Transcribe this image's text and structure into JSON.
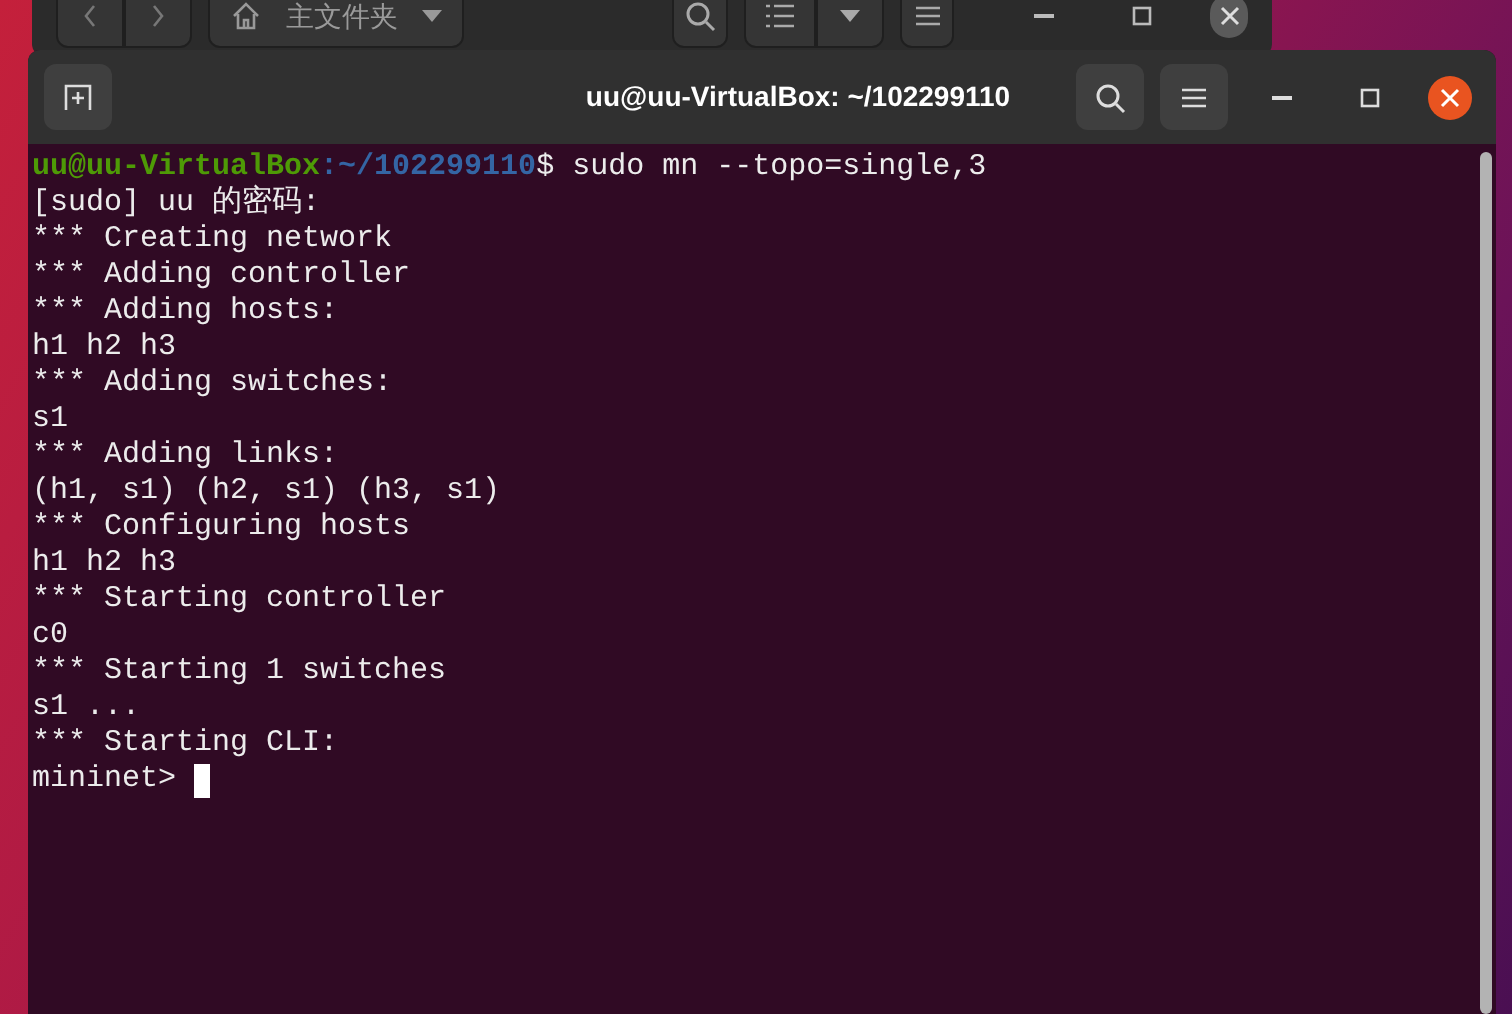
{
  "file_manager": {
    "path_label": "主文件夹"
  },
  "terminal": {
    "title": "uu@uu-VirtualBox: ~/102299110",
    "lines": [
      {
        "kind": "prompt",
        "user_host": "uu@uu-VirtualBox",
        "path": ":~/102299110",
        "command": "$ sudo mn --topo=single,3"
      },
      {
        "kind": "output",
        "text": "[sudo] uu 的密码:"
      },
      {
        "kind": "output",
        "text": "*** Creating network"
      },
      {
        "kind": "output",
        "text": "*** Adding controller"
      },
      {
        "kind": "output",
        "text": "*** Adding hosts:"
      },
      {
        "kind": "output",
        "text": "h1 h2 h3"
      },
      {
        "kind": "output",
        "text": "*** Adding switches:"
      },
      {
        "kind": "output",
        "text": "s1"
      },
      {
        "kind": "output",
        "text": "*** Adding links:"
      },
      {
        "kind": "output",
        "text": "(h1, s1) (h2, s1) (h3, s1)"
      },
      {
        "kind": "output",
        "text": "*** Configuring hosts"
      },
      {
        "kind": "output",
        "text": "h1 h2 h3"
      },
      {
        "kind": "output",
        "text": "*** Starting controller"
      },
      {
        "kind": "output",
        "text": "c0"
      },
      {
        "kind": "output",
        "text": "*** Starting 1 switches"
      },
      {
        "kind": "output",
        "text": "s1 ..."
      },
      {
        "kind": "output",
        "text": "*** Starting CLI:"
      },
      {
        "kind": "input",
        "text": "mininet>"
      }
    ]
  }
}
